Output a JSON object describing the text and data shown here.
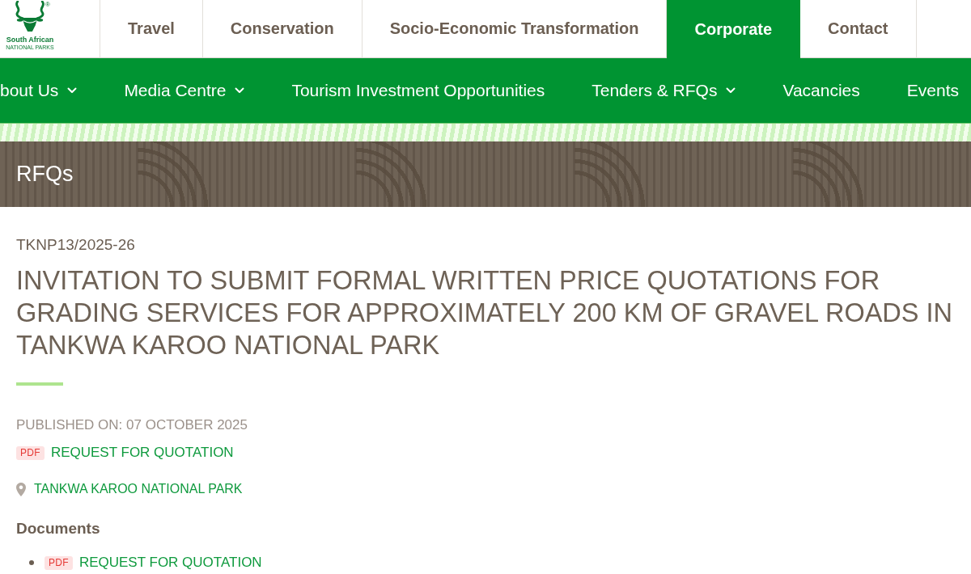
{
  "logo": {
    "name_line_1": "South African",
    "name_line_2": "NATIONAL PARKS",
    "registered_mark": "®"
  },
  "top_tabs": [
    {
      "label": "Travel",
      "selected": false
    },
    {
      "label": "Conservation",
      "selected": false
    },
    {
      "label": "Socio-Economic Transformation",
      "selected": false
    },
    {
      "label": "Corporate",
      "selected": true
    },
    {
      "label": "Contact",
      "selected": false
    }
  ],
  "main_nav": [
    {
      "label": "bout Us",
      "dropdown": true
    },
    {
      "label": "Media Centre",
      "dropdown": true
    },
    {
      "label": "Tourism Investment Opportunities",
      "dropdown": false
    },
    {
      "label": "Tenders & RFQs",
      "dropdown": true
    },
    {
      "label": "Vacancies",
      "dropdown": false
    },
    {
      "label": "Events",
      "dropdown": false
    }
  ],
  "banner": {
    "title": "RFQs"
  },
  "notice": {
    "reference": "TKNP13/2025-26",
    "title": "INVITATION TO SUBMIT FORMAL WRITTEN PRICE QUOTATIONS FOR GRADING SERVICES FOR APPROXIMATELY 200 KM OF GRAVEL ROADS IN TANKWA KAROO NATIONAL PARK",
    "published": "PUBLISHED ON: 07 OCTOBER 2025",
    "attachment": {
      "file_type": "PDF",
      "label": "REQUEST FOR QUOTATION"
    },
    "location": "TANKWA KAROO NATIONAL PARK"
  },
  "documents": {
    "heading": "Documents",
    "items": [
      {
        "file_type": "PDF",
        "label": "REQUEST FOR QUOTATION"
      }
    ]
  }
}
